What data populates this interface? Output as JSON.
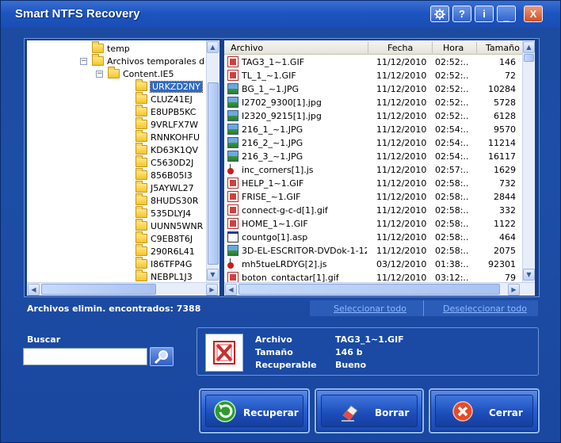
{
  "window": {
    "title": "Smart NTFS Recovery"
  },
  "titlebar_buttons": [
    {
      "name": "settings-button",
      "glyph": "⚙",
      "icon": "gear-icon"
    },
    {
      "name": "help-button",
      "glyph": "?",
      "icon": "help-icon"
    },
    {
      "name": "info-button",
      "glyph": "i",
      "icon": "info-icon"
    },
    {
      "name": "minimize-button",
      "glyph": "_",
      "icon": "minimize-icon"
    },
    {
      "name": "close-window-button",
      "glyph": "X",
      "icon": "close-icon"
    }
  ],
  "tree": {
    "items": [
      {
        "label": "temp",
        "level": 1,
        "expander": "",
        "selected": false
      },
      {
        "label": "Archivos temporales d",
        "level": 1,
        "expander": "−",
        "selected": false
      },
      {
        "label": "Content.IE5",
        "level": 2,
        "expander": "−",
        "selected": false
      },
      {
        "label": "URKZD2NY",
        "level": 3,
        "expander": "",
        "selected": true
      },
      {
        "label": "CLUZ41EJ",
        "level": 3,
        "expander": "",
        "selected": false
      },
      {
        "label": "E8UPB5KC",
        "level": 3,
        "expander": "",
        "selected": false
      },
      {
        "label": "9VRLFX7W",
        "level": 3,
        "expander": "",
        "selected": false
      },
      {
        "label": "RNNKOHFU",
        "level": 3,
        "expander": "",
        "selected": false
      },
      {
        "label": "KD63K1QV",
        "level": 3,
        "expander": "",
        "selected": false
      },
      {
        "label": "C5630D2J",
        "level": 3,
        "expander": "",
        "selected": false
      },
      {
        "label": "856B05I3",
        "level": 3,
        "expander": "",
        "selected": false
      },
      {
        "label": "J5AYWL27",
        "level": 3,
        "expander": "",
        "selected": false
      },
      {
        "label": "8HUDS30R",
        "level": 3,
        "expander": "",
        "selected": false
      },
      {
        "label": "535DLYJ4",
        "level": 3,
        "expander": "",
        "selected": false
      },
      {
        "label": "UUNN5WNR",
        "level": 3,
        "expander": "",
        "selected": false
      },
      {
        "label": "C9EB8T6J",
        "level": 3,
        "expander": "",
        "selected": false
      },
      {
        "label": "290R6L41",
        "level": 3,
        "expander": "",
        "selected": false
      },
      {
        "label": "I86TFP4G",
        "level": 3,
        "expander": "",
        "selected": false
      },
      {
        "label": "NEBPL1J3",
        "level": 3,
        "expander": "",
        "selected": false
      }
    ]
  },
  "file_list": {
    "columns": [
      "Archivo",
      "Fecha",
      "Hora",
      "Tamaño"
    ],
    "rows": [
      {
        "icon": "gif",
        "name": "TAG3_1~1.GIF",
        "date": "11/12/2010",
        "time": "02:52:..",
        "size": "146"
      },
      {
        "icon": "gif",
        "name": "TL_1_~1.GIF",
        "date": "11/12/2010",
        "time": "02:52:..",
        "size": "72"
      },
      {
        "icon": "jpg",
        "name": "BG_1_~1.JPG",
        "date": "11/12/2010",
        "time": "02:52:..",
        "size": "10284"
      },
      {
        "icon": "jpg",
        "name": "I2702_9300[1].jpg",
        "date": "11/12/2010",
        "time": "02:52:..",
        "size": "5728"
      },
      {
        "icon": "jpg",
        "name": "I2320_9215[1].jpg",
        "date": "11/12/2010",
        "time": "02:52:..",
        "size": "6128"
      },
      {
        "icon": "jpg",
        "name": "216_1_~1.JPG",
        "date": "11/12/2010",
        "time": "02:54:..",
        "size": "9570"
      },
      {
        "icon": "jpg",
        "name": "216_2_~1.JPG",
        "date": "11/12/2010",
        "time": "02:54:..",
        "size": "11214"
      },
      {
        "icon": "jpg",
        "name": "216_3_~1.JPG",
        "date": "11/12/2010",
        "time": "02:54:..",
        "size": "16117"
      },
      {
        "icon": "js",
        "name": "inc_corners[1].js",
        "date": "11/12/2010",
        "time": "02:57:..",
        "size": "1629"
      },
      {
        "icon": "gif",
        "name": "HELP_1~1.GIF",
        "date": "11/12/2010",
        "time": "02:58:..",
        "size": "732"
      },
      {
        "icon": "gif",
        "name": "FRISE_~1.GIF",
        "date": "11/12/2010",
        "time": "02:58:..",
        "size": "2844"
      },
      {
        "icon": "gif",
        "name": "connect-g-c-d[1].gif",
        "date": "11/12/2010",
        "time": "02:58:..",
        "size": "332"
      },
      {
        "icon": "gif",
        "name": "HOME_1~1.GIF",
        "date": "11/12/2010",
        "time": "02:58:..",
        "size": "1122"
      },
      {
        "icon": "asp",
        "name": "countgo[1].asp",
        "date": "11/12/2010",
        "time": "02:58:..",
        "size": "464"
      },
      {
        "icon": "jpg",
        "name": "3D-EL-ESCRITOR-DVDok-1-12...",
        "date": "11/12/2010",
        "time": "02:58:..",
        "size": "2075"
      },
      {
        "icon": "js",
        "name": "mh5tueLRDYG[2].js",
        "date": "03/12/2010",
        "time": "01:38:..",
        "size": "92301"
      },
      {
        "icon": "gif",
        "name": "boton_contactar[1].gif",
        "date": "11/12/2010",
        "time": "03:12:..",
        "size": "79"
      }
    ]
  },
  "status": {
    "found_text": "Archivos elimin. encontrados: 7388"
  },
  "links": {
    "select_all": "Seleccionar todo",
    "deselect_all": "Deseleccionar todo"
  },
  "search": {
    "label": "Buscar",
    "value": "",
    "placeholder": ""
  },
  "details": {
    "file_label": "Archivo",
    "file_value": "TAG3_1~1.GIF",
    "size_label": "Tamaño",
    "size_value": "146 b",
    "recoverable_label": "Recuperable",
    "recoverable_value": "Bueno"
  },
  "actions": {
    "recover": "Recuperar",
    "delete": "Borrar",
    "close": "Cerrar"
  },
  "colors": {
    "accent": "#1c4aa0",
    "selection": "#316ac5",
    "link": "#8fb8ff"
  }
}
